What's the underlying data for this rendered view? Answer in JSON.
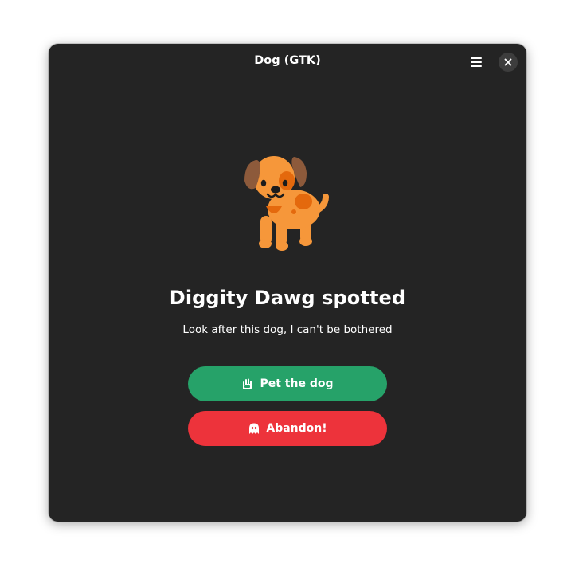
{
  "window": {
    "title": "Dog (GTK)"
  },
  "headerbar": {
    "menu_icon": "hamburger-menu-icon",
    "close_icon": "close-icon"
  },
  "content": {
    "illustration_icon": "dog-icon",
    "heading": "Diggity Dawg spotted",
    "subtitle": "Look after this dog, I can't be bothered"
  },
  "actions": {
    "pet": {
      "label": "Pet the dog",
      "icon": "hand-icon",
      "color": "#26a269"
    },
    "abandon": {
      "label": "Abandon!",
      "icon": "ghost-icon",
      "color": "#ed333b"
    }
  },
  "theme": {
    "window_bg": "#242424",
    "text": "#ffffff"
  }
}
